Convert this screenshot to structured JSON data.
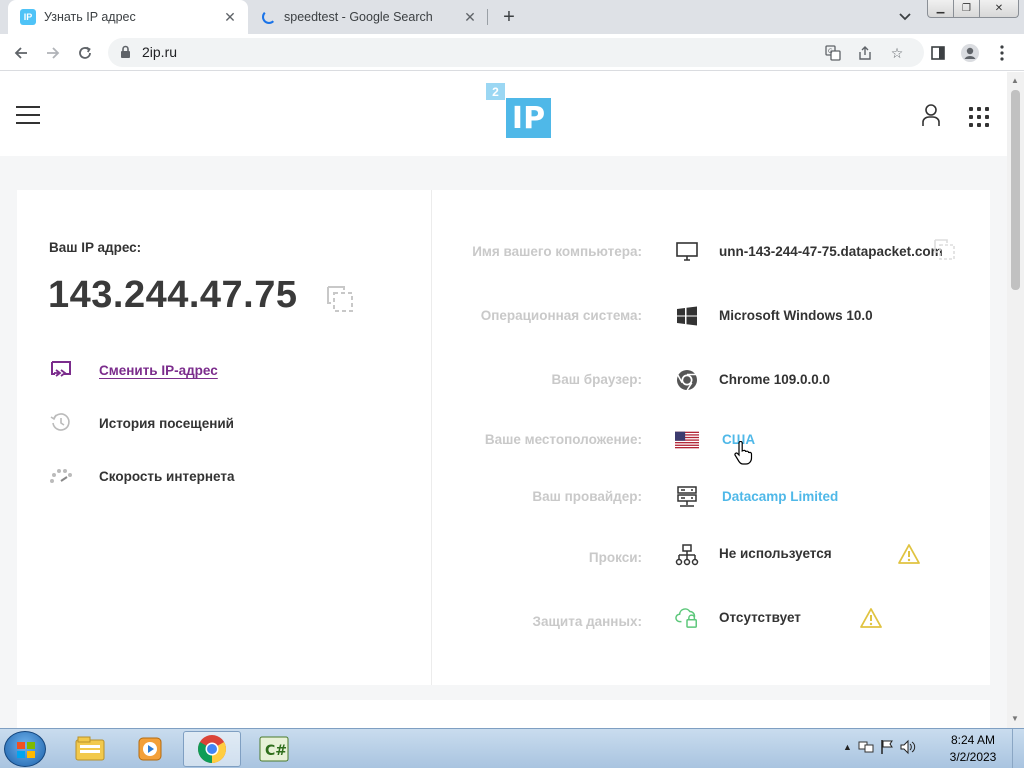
{
  "browser": {
    "tabs": [
      {
        "title": "Узнать IP адрес",
        "favicon": "IP",
        "active": true
      },
      {
        "title": "speedtest - Google Search",
        "active": false
      }
    ],
    "url": "2ip.ru"
  },
  "site": {
    "logo_small": "2",
    "logo_big": "IP",
    "ip_label": "Ваш IP адрес:",
    "ip_value": "143.244.47.75",
    "menu": [
      {
        "label": "Сменить IP-адрес",
        "icon": "change-ip-icon"
      },
      {
        "label": "История посещений",
        "icon": "history-icon"
      },
      {
        "label": "Скорость интернета",
        "icon": "speed-icon"
      }
    ],
    "info": [
      {
        "key": "Имя вашего компьютера:",
        "value": "unn-143-244-47-75.datapacket.com",
        "icon": "monitor-icon"
      },
      {
        "key": "Операционная система:",
        "value": "Microsoft Windows 10.0",
        "icon": "windows-icon"
      },
      {
        "key": "Ваш браузер:",
        "value": "Chrome 109.0.0.0",
        "icon": "chrome-icon"
      },
      {
        "key": "Ваше местоположение:",
        "value": "США",
        "icon": "us-flag-icon"
      },
      {
        "key": "Ваш провайдер:",
        "value": "Datacamp Limited",
        "icon": "server-icon"
      },
      {
        "key": "Прокси:",
        "value": "Не используется",
        "icon": "network-icon"
      },
      {
        "key": "Защита данных:",
        "value": "Отсутствует",
        "icon": "cloud-lock-icon"
      }
    ]
  },
  "taskbar": {
    "time": "8:24 AM",
    "date": "3/2/2023",
    "apps": [
      "explorer-icon",
      "media-player-icon",
      "chrome-icon",
      "csharp-icon"
    ]
  },
  "colors": {
    "accent": "#4fb8e8",
    "link_purple": "#7b2c8c",
    "warning": "#e0c341"
  }
}
